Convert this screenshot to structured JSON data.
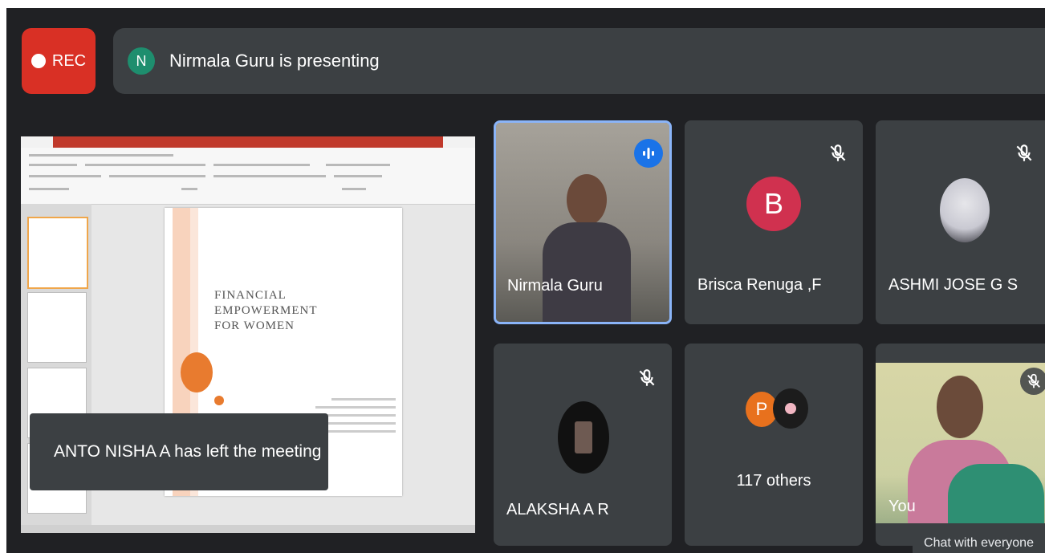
{
  "recording": {
    "label": "REC"
  },
  "presenting": {
    "avatar_letter": "N",
    "text": "Nirmala Guru is presenting"
  },
  "presentation": {
    "slide_title_line1": "FINANCIAL EMPOWERMENT",
    "slide_title_line2": "FOR WOMEN"
  },
  "toast": {
    "text": "ANTO NISHA A has left the meeting"
  },
  "participants": [
    {
      "name": "Nirmala Guru",
      "speaking": true
    },
    {
      "name": "Brisca Renuga ,F",
      "avatar_letter": "B",
      "avatar_color": "#d0314f",
      "muted": true
    },
    {
      "name": "ASHMI JOSE G S",
      "muted": true
    },
    {
      "name": "ALAKSHA A R",
      "muted": true
    },
    {
      "name": "117 others",
      "avatar_letter": "P",
      "avatar_color": "#e8711d"
    },
    {
      "name": "You",
      "muted": true
    }
  ],
  "chat": {
    "label": "Chat with everyone"
  },
  "colors": {
    "rec": "#d93025",
    "accent_blue": "#1a73e8",
    "tile_bg": "#3c4043",
    "meeting_bg": "#202124"
  }
}
